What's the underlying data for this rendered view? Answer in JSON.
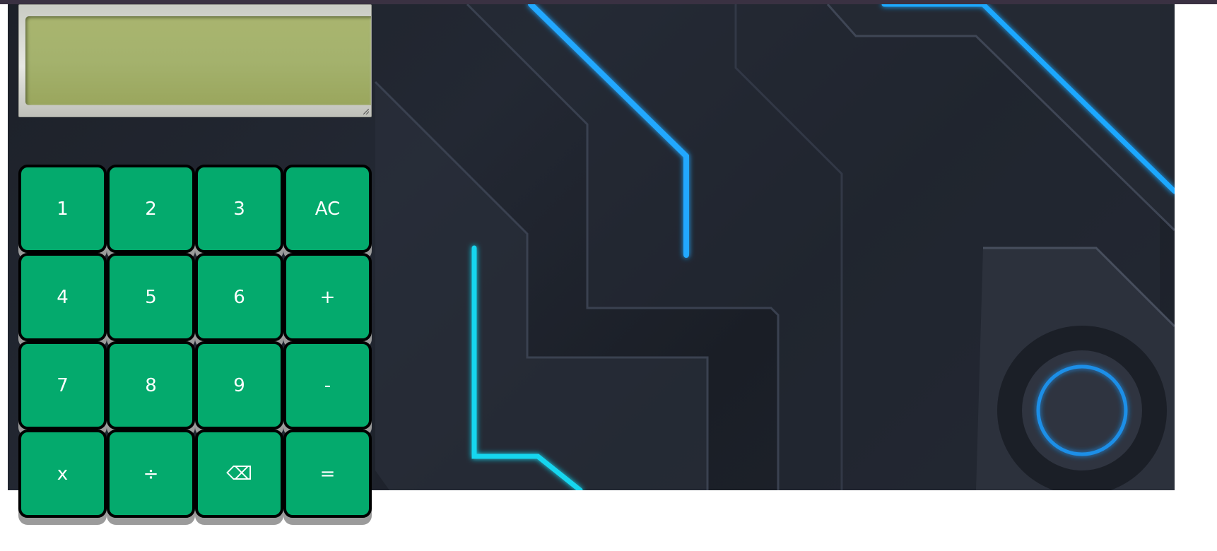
{
  "display": {
    "value": ""
  },
  "keys": [
    {
      "label": "1",
      "name": "key-1"
    },
    {
      "label": "2",
      "name": "key-2"
    },
    {
      "label": "3",
      "name": "key-3"
    },
    {
      "label": "AC",
      "name": "all-clear-button"
    },
    {
      "label": "4",
      "name": "key-4"
    },
    {
      "label": "5",
      "name": "key-5"
    },
    {
      "label": "6",
      "name": "key-6"
    },
    {
      "label": "+",
      "name": "add-button"
    },
    {
      "label": "7",
      "name": "key-7"
    },
    {
      "label": "8",
      "name": "key-8"
    },
    {
      "label": "9",
      "name": "key-9"
    },
    {
      "label": "-",
      "name": "subtract-button"
    },
    {
      "label": "x",
      "name": "multiply-button"
    },
    {
      "label": "÷",
      "name": "divide-button"
    },
    {
      "label": "⌫",
      "name": "backspace-button"
    },
    {
      "label": "=",
      "name": "equals-button"
    }
  ],
  "colors": {
    "key_face": "#04aa6d",
    "key_border": "#000000",
    "key_shadow": "#9b9b9b",
    "lcd": "#a6b26b",
    "accent_glow": "#1fa8ff"
  }
}
